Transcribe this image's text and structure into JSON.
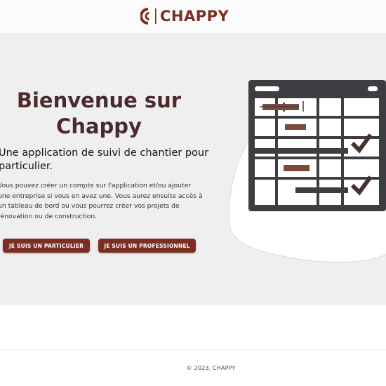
{
  "header": {
    "brand_name": "CHAPPY",
    "brand_color": "#7a2f22"
  },
  "hero": {
    "title": "Bienvenue sur Chappy",
    "subtitle": "Une application de suivi de chantier pour particulier.",
    "description": "Vous pouvez créer un compte sur l'application et/ou ajouter une entreprise si vous en avez une. Vous aurez ensuite accès à un tableau de bord ou vous pourrez créer vos projets de rénovation ou de construction.",
    "buttons": {
      "particulier_label": "JE SUIS UN PARTICULIER",
      "professionnel_label": "JE SUIS UN PROFESSIONNEL"
    },
    "illustration_icons": [
      "calendar-grid-icon",
      "checkmark-icon"
    ]
  },
  "footer": {
    "copyright": "© 2023, CHAPPY"
  },
  "colors": {
    "accent": "#7a2f22",
    "title": "#4a2a2e",
    "hero_background": "#efefef",
    "illustration_dark": "#3e3d42"
  }
}
